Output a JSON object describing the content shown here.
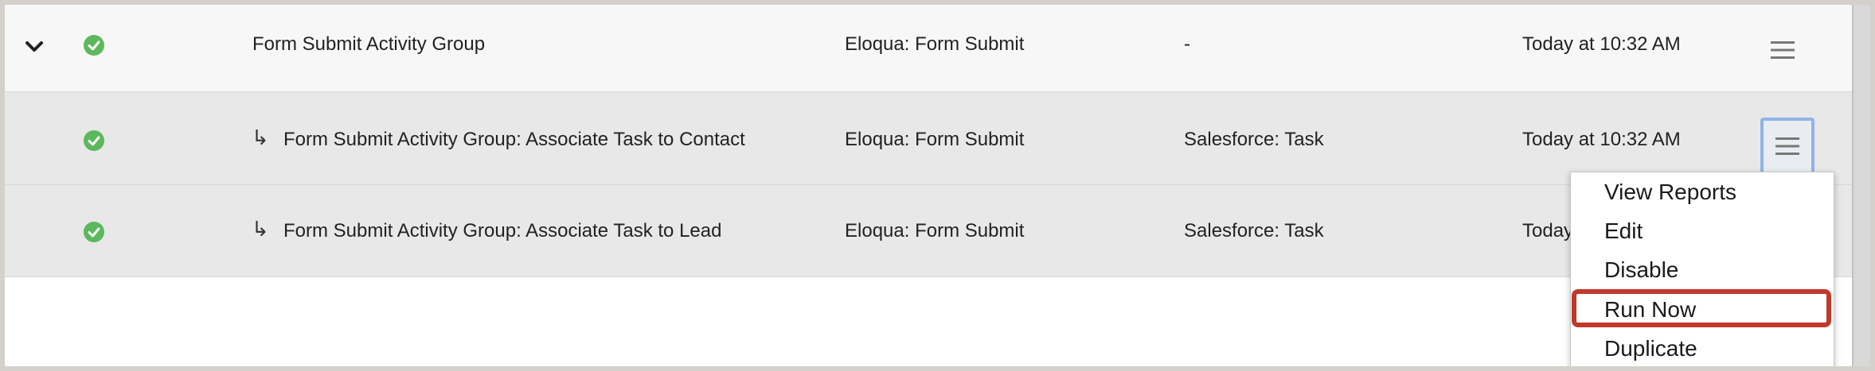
{
  "rows": [
    {
      "name": "Form Submit Activity Group",
      "source": "Eloqua: Form Submit",
      "destination": "-",
      "time": "Today at 10:32 AM"
    },
    {
      "name": "Form Submit Activity Group: Associate Task to Contact",
      "source": "Eloqua: Form Submit",
      "destination": "Salesforce: Task",
      "time": "Today at 10:32 AM"
    },
    {
      "name": "Form Submit Activity Group: Associate Task to Lead",
      "source": "Eloqua: Form Submit",
      "destination": "Salesforce: Task",
      "time": "Today"
    }
  ],
  "subitem_arrow": "↳",
  "menu": {
    "items": [
      "View Reports",
      "Edit",
      "Disable",
      "Run Now",
      "Duplicate"
    ],
    "highlighted": "Run Now"
  },
  "colors": {
    "status_ok": "#5cb85c",
    "highlight": "#c0392b",
    "active_button_border": "#8fb4e8"
  },
  "icons": [
    "chevron-down-icon",
    "check-circle-icon",
    "hamburger-menu-icon"
  ]
}
